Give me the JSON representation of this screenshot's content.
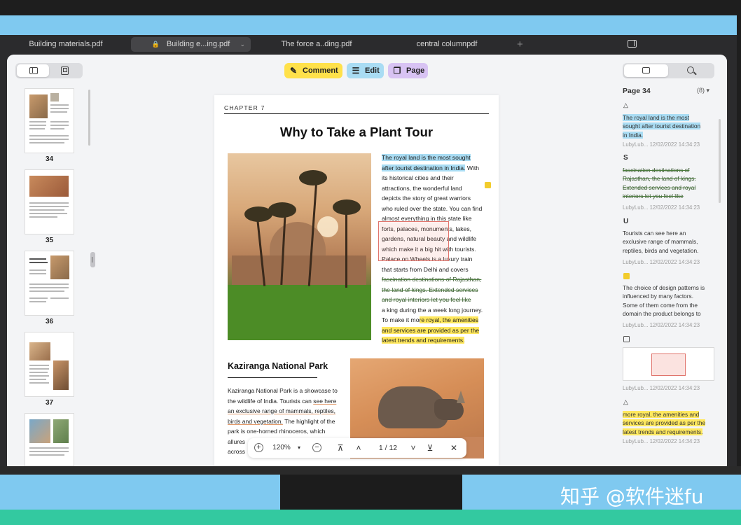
{
  "tabs": [
    {
      "label": "Building materials.pdf"
    },
    {
      "label": "Building e...ing.pdf"
    },
    {
      "label": "The force a..ding.pdf"
    },
    {
      "label": "central columnpdf"
    }
  ],
  "toolbar": {
    "comment": "Comment",
    "edit": "Edit",
    "page": "Page"
  },
  "thumbnails": [
    {
      "page": "34"
    },
    {
      "page": "35"
    },
    {
      "page": "36"
    },
    {
      "page": "37"
    }
  ],
  "document": {
    "chapter": "CHAPTER 7",
    "title": "Why to Take a Plant Tour",
    "para1": [
      "The royal land is the most sought",
      "after tourist destination in India.",
      " With",
      "its historical cities and their",
      "attractions, the wonderful land",
      "depicts the story of great warriors",
      "who ruled over the state. You can find",
      "almost everything in this state like",
      "forts, palaces, monuments, lakes,",
      "gardens, natural beauty and wildlife",
      "which make it a big hit with tourists.",
      "Palace on Wheels is a luxury train",
      "that starts from Delhi and covers",
      "fascination destinations of Rajasthan,",
      "the land of kings. Extended services",
      "and royal interiors let you feel like",
      "a king during the a week long journey.",
      "To make it mo",
      "re royal, the amenities",
      "and services are provided as per the",
      "latest trends and requirements."
    ],
    "heading2": "Kaziranga National Park",
    "para2": [
      "Kaziranga National Park is a showcase to",
      "the wildlife of India. Tourists can ",
      "see here",
      "an exclusive range of mammals, reptiles,",
      "birds and vegetation.",
      " The highlight of the",
      "park is one-horned rhinoceros, which",
      "allures",
      "across"
    ]
  },
  "navbar": {
    "zoom": "120%",
    "page": "1 / 12"
  },
  "right_panel": {
    "title": "Page 34",
    "count": "(8)",
    "annotations": [
      {
        "icon": "highlight-icon",
        "lines": [
          "The royal land is the most",
          "sought after tourist destination",
          "in India."
        ],
        "meta": "LubyLub... 12/02/2022 14:34:23"
      },
      {
        "icon": "strikethrough-icon",
        "glyph": "S",
        "lines": [
          "fascination destinations of",
          "Rajasthan, the land of kings.",
          "Extended services and royal",
          "interiors let you feel like"
        ],
        "meta": "LubyLub... 12/02/2022 14:34:23"
      },
      {
        "icon": "underline-icon",
        "glyph": "U",
        "lines": [
          "Tourists can see here an",
          "exclusive range of mammals,",
          "reptiles, birds and vegetation."
        ],
        "meta": "LubyLub... 12/02/2022 14:34:23"
      },
      {
        "icon": "sticky-note-icon",
        "lines": [
          "The choice of design patterns is",
          "influenced by many factors.",
          "Some of them come from the",
          "domain the product belongs to"
        ],
        "meta": "LubyLub... 12/02/2022 14:34:23"
      },
      {
        "icon": "rectangle-icon",
        "meta": "LubyLub... 12/02/2022 14:34:23"
      },
      {
        "icon": "highlight-icon",
        "lines": [
          "more royal, the amenities and",
          "services are provided as per the",
          "latest trends and requirements."
        ],
        "meta": "LubyLub... 12/02/2022 14:34:23"
      }
    ]
  },
  "watermark": "知乎 @软件迷fu",
  "colors": {
    "comment": "#ffe14a",
    "edit": "#a9dcf3",
    "page": "#d8c3f3",
    "highlight_blue": "#a9dcf3",
    "highlight_yellow": "#ffe85e",
    "rect_red": "#e0746c"
  }
}
